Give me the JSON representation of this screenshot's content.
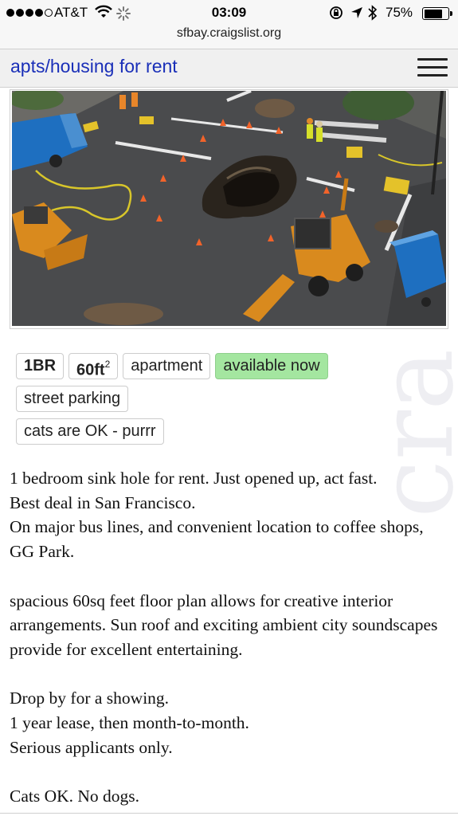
{
  "status_bar": {
    "carrier": "AT&T",
    "time": "03:09",
    "battery_percent": "75%",
    "battery_level": 0.75,
    "url": "sfbay.craigslist.org",
    "icons": [
      "signal-dots",
      "wifi-icon",
      "activity-spinner",
      "rotation-lock-icon",
      "location-arrow-icon",
      "bluetooth-icon",
      "battery-icon"
    ]
  },
  "header": {
    "title": "apts/housing for rent",
    "menu_icon": "hamburger-menu-icon"
  },
  "photo": {
    "description_icon": "listing-photo"
  },
  "attributes": {
    "bedrooms": "1BR",
    "area_value": "60ft",
    "area_exponent": "2",
    "type": "apartment",
    "availability": "available now",
    "parking": "street parking",
    "pets": "cats are OK - purrr"
  },
  "posting": {
    "line1": "1 bedroom sink hole for rent. Just opened up, act fast.",
    "line2": "Best deal in San Francisco.",
    "line3": "On major bus lines, and convenient location to coffee shops, GG Park.",
    "line4": "spacious 60sq feet floor plan allows for creative interior arrangements. Sun roof and exciting ambient city soundscapes provide for excellent entertaining.",
    "line5": "Drop by for a showing.",
    "line6": "1 year lease, then month-to-month.",
    "line7": "Serious applicants only.",
    "line8": "Cats OK. No dogs."
  },
  "watermark": "cra",
  "colors": {
    "link_blue": "#1a2fb8",
    "available_green": "#a4e6a0",
    "header_bg": "#f0f0f0"
  }
}
